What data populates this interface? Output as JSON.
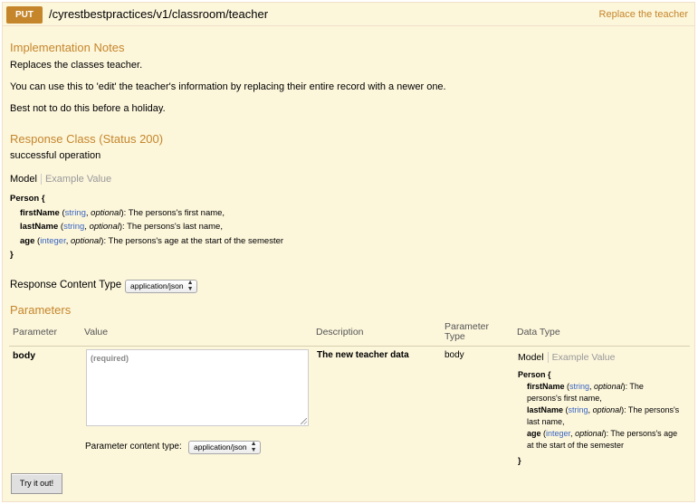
{
  "operation": {
    "method": "PUT",
    "path": "/cyrestbestpractices/v1/classroom/teacher",
    "summary": "Replace the teacher"
  },
  "implementation_notes": {
    "heading": "Implementation Notes",
    "line1": "Replaces the classes teacher.",
    "line2": "You can use this to 'edit' the teacher's information by replacing their entire record with a newer one.",
    "line3": "Best not to do this before a holiday."
  },
  "response_class": {
    "heading": "Response Class (Status 200)",
    "description": "successful operation",
    "tab_model": "Model",
    "tab_example": "Example Value",
    "model": {
      "name": "Person {",
      "close": "}",
      "fields": [
        {
          "name": "firstName",
          "type": "string",
          "opt": "optional",
          "desc": "): The persons's first name,"
        },
        {
          "name": "lastName",
          "type": "string",
          "opt": "optional",
          "desc": "): The persons's last name,"
        },
        {
          "name": "age",
          "type": "integer",
          "opt": "optional",
          "desc": "): The persons's age at the start of the semester"
        }
      ]
    }
  },
  "response_content_type": {
    "label": "Response Content Type",
    "value": "application/json"
  },
  "parameters": {
    "heading": "Parameters",
    "columns": {
      "parameter": "Parameter",
      "value": "Value",
      "description": "Description",
      "parameter_type_1": "Parameter",
      "parameter_type_2": "Type",
      "data_type": "Data Type"
    },
    "row": {
      "name": "body",
      "placeholder": "(required)",
      "description": "The new teacher data",
      "param_type": "body",
      "content_type_label": "Parameter content type:",
      "content_type_value": "application/json",
      "tab_model": "Model",
      "tab_example": "Example Value",
      "model": {
        "name": "Person {",
        "close": "}",
        "lines": [
          {
            "name": "firstName",
            "type": "string",
            "opt": "optional",
            "tail": "): The",
            "cont": "persons's first name,"
          },
          {
            "name": "lastName",
            "type": "string",
            "opt": "optional",
            "tail": "): The persons's",
            "cont": "last name,"
          },
          {
            "name": "age",
            "type": "integer",
            "opt": "optional",
            "tail": "): The persons's age",
            "cont": "at the start of the semester"
          }
        ]
      }
    }
  },
  "try_button": "Try it out!"
}
